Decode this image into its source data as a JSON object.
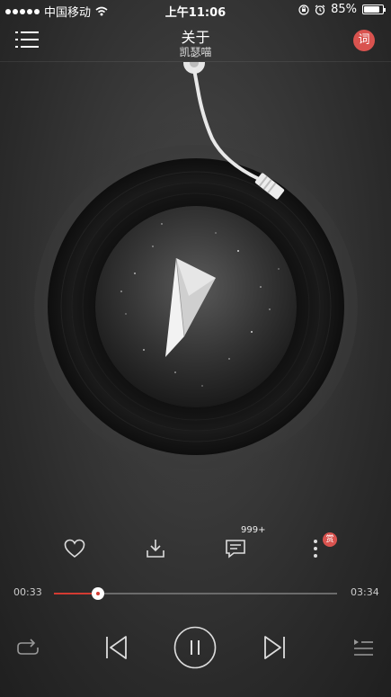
{
  "status_bar": {
    "carrier": "中国移动",
    "time": "上午11:06",
    "battery_text": "85%",
    "battery_level": 0.85,
    "icons": [
      "signal-dots-icon",
      "wifi-icon",
      "orientation-lock-icon",
      "alarm-icon",
      "battery-icon"
    ]
  },
  "header": {
    "title": "关于",
    "artist": "凯瑟喵",
    "lyrics_label": "词",
    "menu_icon": "list-menu-icon"
  },
  "album": {
    "art_icon": "paper-plane-icon",
    "disc_icon": "vinyl-record-icon",
    "tonearm_icon": "tonearm-icon"
  },
  "actions": {
    "comment_count": "999+",
    "reward_label": "赏",
    "icons": [
      "heart-icon",
      "download-icon",
      "comment-icon",
      "more-icon"
    ]
  },
  "progress": {
    "elapsed": "00:33",
    "total": "03:34",
    "fraction": 0.154
  },
  "playback": {
    "icons": [
      "repeat-icon",
      "previous-icon",
      "pause-icon",
      "next-icon",
      "playlist-icon"
    ],
    "state": "playing"
  },
  "colors": {
    "accent": "#d33b32",
    "badge": "#d9534f"
  }
}
